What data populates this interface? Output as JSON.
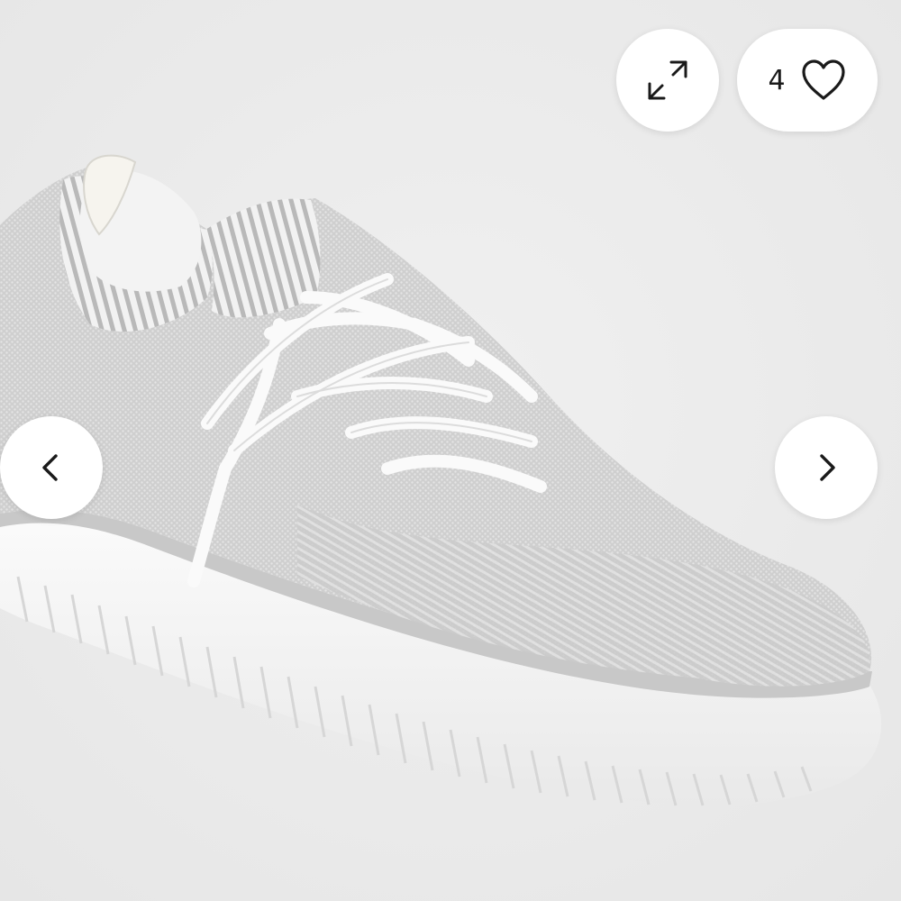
{
  "gallery": {
    "favorite_count": "4",
    "icons": {
      "expand": "expand-arrows-icon",
      "favorite": "heart-outline-icon",
      "previous": "chevron-left-icon",
      "next": "chevron-right-icon"
    },
    "colors": {
      "background": "#ececec",
      "button_bg": "#ffffff",
      "icon": "#1a1a1a"
    }
  }
}
